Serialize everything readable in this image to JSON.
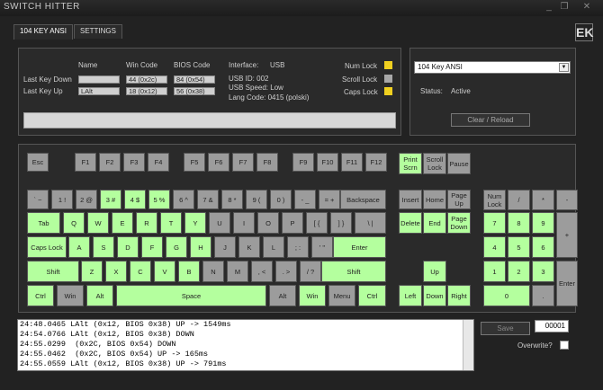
{
  "window": {
    "title": "SWITCH HITTER",
    "min": "_",
    "max": "❐",
    "close": "✕"
  },
  "tabs": [
    {
      "label": "104 KEY ANSI"
    },
    {
      "label": "SETTINGS"
    }
  ],
  "logo": "EK",
  "info": {
    "headers": {
      "name": "Name",
      "win_code": "Win Code",
      "bios_code": "BIOS Code"
    },
    "last_down": {
      "label": "Last Key Down",
      "name": "",
      "win": "44 (0x2c)",
      "bios": "84 (0x54)"
    },
    "last_up": {
      "label": "Last Key Up",
      "name": "LAlt",
      "win": "18 (0x12)",
      "bios": "56 (0x38)"
    },
    "interface": {
      "label": "Interface:",
      "value": "USB"
    },
    "usb_id": "USB ID:  002",
    "usb_speed": "USB Speed:  Low",
    "lang_code": "Lang Code:  0415 (polski)",
    "locks": [
      {
        "label": "Num Lock",
        "color": "#f0d020"
      },
      {
        "label": "Scroll Lock",
        "color": "#a8a8a8"
      },
      {
        "label": "Caps Lock",
        "color": "#f0d020"
      }
    ]
  },
  "right": {
    "layout": "104 Key ANSI",
    "status_label": "Status:",
    "status_value": "Active",
    "clear": "Clear / Reload"
  },
  "keys": {
    "esc": "Esc",
    "f1": "F1",
    "f2": "F2",
    "f3": "F3",
    "f4": "F4",
    "f5": "F5",
    "f6": "F6",
    "f7": "F7",
    "f8": "F8",
    "f9": "F9",
    "f10": "F10",
    "f11": "F11",
    "f12": "F12",
    "prtsc": "Print\nScrn",
    "scrlk": "Scroll\nLock",
    "pause": "Pause",
    "grave": "` ~",
    "1": "1 !",
    "2": "2 @",
    "3": "3 #",
    "4": "4 $",
    "5": "5 %",
    "6": "6 ^",
    "7": "7 &",
    "8": "8 *",
    "9": "9 (",
    "0": "0 )",
    "minus": "- _",
    "eq": "= +",
    "bksp": "Backspace",
    "ins": "Insert",
    "home": "Home",
    "pgup": "Page\nUp",
    "numlk": "Num\nLock",
    "ndiv": "/",
    "nmul": "*",
    "nsub": "-",
    "tab": "Tab",
    "q": "Q",
    "w": "W",
    "e": "E",
    "r": "R",
    "t": "T",
    "y": "Y",
    "u": "U",
    "i": "I",
    "o": "O",
    "p": "P",
    "lbr": "[ {",
    "rbr": "] }",
    "bsl": "\\ |",
    "del": "Delete",
    "end": "End",
    "pgdn": "Page\nDown",
    "n7": "7",
    "n8": "8",
    "n9": "9",
    "nadd": "+",
    "caps": "Caps Lock",
    "a": "A",
    "s": "S",
    "d": "D",
    "f": "F",
    "g": "G",
    "h": "H",
    "j": "J",
    "k": "K",
    "l": "L",
    "semi": "; :",
    "quote": "' \"",
    "enter": "Enter",
    "n4": "4",
    "n5": "5",
    "n6": "6",
    "lshift": "Shift",
    "z": "Z",
    "x": "X",
    "c": "C",
    "v": "V",
    "b": "B",
    "n": "N",
    "m": "M",
    "comma": ", <",
    "dot": ". >",
    "slash": "/ ?",
    "rshift": "Shift",
    "up": "Up",
    "n1": "1",
    "n2": "2",
    "n3": "3",
    "nenter": "Enter",
    "lctrl": "Ctrl",
    "lwin": "Win",
    "lalt": "Alt",
    "space": "Space",
    "ralt": "Alt",
    "rwin": "Win",
    "menu": "Menu",
    "rctrl": "Ctrl",
    "left": "Left",
    "down": "Down",
    "right": "Right",
    "n0": "0",
    "ndot": "."
  },
  "log": [
    "24:48.0465 LAlt (0x12, BIOS 0x38) UP -> 1549ms",
    "24:54.0766 LAlt (0x12, BIOS 0x38) DOWN",
    "24:55.0299  (0x2C, BIOS 0x54) DOWN",
    "24:55.0462  (0x2C, BIOS 0x54) UP -> 165ms",
    "24:55.0559 LAlt (0x12, BIOS 0x38) UP -> 791ms"
  ],
  "save": "Save",
  "counter": "00001",
  "overwrite": "Overwrite?"
}
